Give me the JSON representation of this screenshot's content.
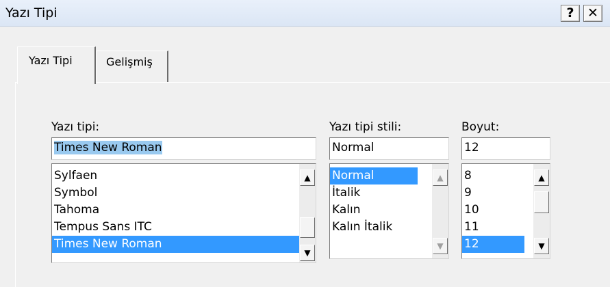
{
  "window": {
    "title": "Yazı Tipi",
    "help_label": "?",
    "close_label": "✕"
  },
  "tabs": [
    {
      "label": "Yazı Tipi",
      "active": true
    },
    {
      "label": "Gelişmiş",
      "active": false
    }
  ],
  "font": {
    "label": "Yazı tipi:",
    "value": "Times New Roman",
    "items": [
      "Sylfaen",
      "Symbol",
      "Tahoma",
      "Tempus Sans ITC",
      "Times New Roman"
    ],
    "selected": "Times New Roman"
  },
  "style": {
    "label": "Yazı tipi stili:",
    "value": "Normal",
    "items": [
      "Normal",
      "İtalik",
      "Kalın",
      "Kalın İtalik"
    ],
    "selected": "Normal"
  },
  "size": {
    "label": "Boyut:",
    "value": "12",
    "items": [
      "8",
      "9",
      "10",
      "11",
      "12"
    ],
    "selected": "12"
  },
  "icons": {
    "scroll_up": "▲",
    "scroll_down": "▼"
  }
}
